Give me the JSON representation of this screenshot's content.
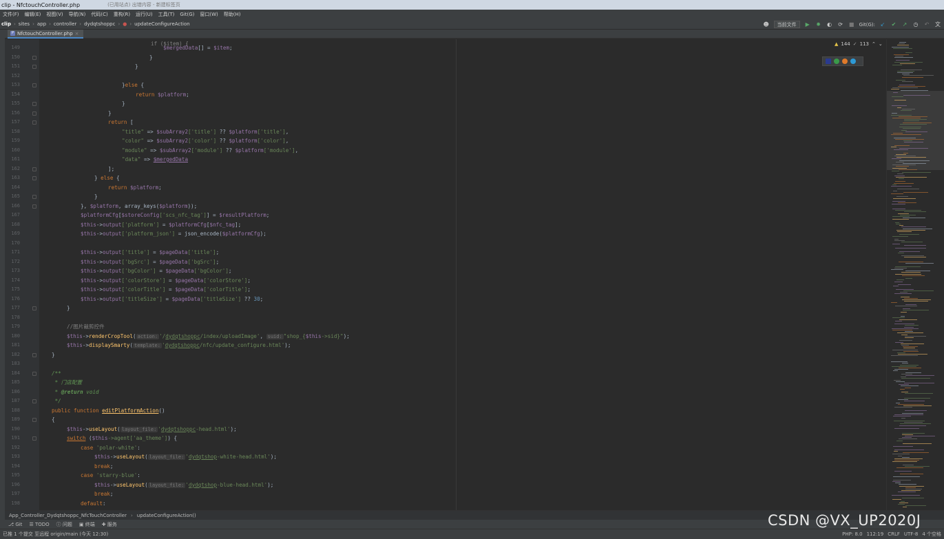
{
  "window": {
    "title": "clip - NfctouchController.php",
    "ghost_tab": "(已用站点) 出错内容 - 新建标签页"
  },
  "menu": [
    "文件(F)",
    "编辑(E)",
    "视图(V)",
    "导航(N)",
    "代码(C)",
    "重构(R)",
    "运行(U)",
    "工具(T)",
    "Git(G)",
    "窗口(W)",
    "帮助(H)"
  ],
  "breadcrumb": [
    "clip",
    "sites",
    "app",
    "controller",
    "dydqtshoppc",
    "updateConfigureAction"
  ],
  "toolbar": {
    "combo": "当前文件",
    "git_label": "Git(G):"
  },
  "tab": {
    "label": "NfctouchController.php",
    "icon": "php-file-icon"
  },
  "inspections": {
    "warnings": "144",
    "weak_warnings": "113"
  },
  "lines": [
    {
      "n": "148",
      "fold": true
    },
    {
      "n": "149"
    },
    {
      "n": "150",
      "fold": true
    },
    {
      "n": "151",
      "fold": true
    },
    {
      "n": "152"
    },
    {
      "n": "153",
      "fold": true
    },
    {
      "n": "154"
    },
    {
      "n": "155",
      "fold": true
    },
    {
      "n": "156",
      "fold": true
    },
    {
      "n": "157",
      "fold": true
    },
    {
      "n": "158"
    },
    {
      "n": "159"
    },
    {
      "n": "160"
    },
    {
      "n": "161"
    },
    {
      "n": "162",
      "fold": true
    },
    {
      "n": "163",
      "fold": true
    },
    {
      "n": "164"
    },
    {
      "n": "165",
      "fold": true
    },
    {
      "n": "166",
      "fold": true
    },
    {
      "n": "167"
    },
    {
      "n": "168"
    },
    {
      "n": "169"
    },
    {
      "n": "170"
    },
    {
      "n": "171"
    },
    {
      "n": "172"
    },
    {
      "n": "173"
    },
    {
      "n": "174"
    },
    {
      "n": "175"
    },
    {
      "n": "176"
    },
    {
      "n": "177",
      "fold": true
    },
    {
      "n": "178"
    },
    {
      "n": "179"
    },
    {
      "n": "180"
    },
    {
      "n": "181"
    },
    {
      "n": "182",
      "fold": true
    },
    {
      "n": "183"
    },
    {
      "n": "184",
      "fold": true
    },
    {
      "n": "185"
    },
    {
      "n": "186"
    },
    {
      "n": "187",
      "fold": true
    },
    {
      "n": "188"
    },
    {
      "n": "189",
      "fold": true
    },
    {
      "n": "190"
    },
    {
      "n": "191",
      "fold": true
    },
    {
      "n": "192"
    },
    {
      "n": "193"
    },
    {
      "n": "194"
    },
    {
      "n": "195"
    },
    {
      "n": "196"
    },
    {
      "n": "197"
    },
    {
      "n": "198"
    }
  ],
  "code": {
    "l148": "if ($item) {",
    "l149a": "$mergedData",
    "l149b": "[] = ",
    "l149c": "$item",
    "l149d": ";",
    "l150": "}",
    "l151": "}",
    "l153a": "}",
    "l153b": "else",
    "l153c": " {",
    "l154a": "return ",
    "l154b": "$platform",
    "l154c": ";",
    "l155": "}",
    "l156": "}",
    "l157a": "return",
    "l157b": " [",
    "l158a": "\"title\"",
    "l158b": " => ",
    "l158c": "$subArray2",
    "l158d": "['title']",
    "l158e": " ?? ",
    "l158f": "$platform",
    "l158g": "['title']",
    "l158h": ",",
    "l159a": "\"color\"",
    "l159b": " => ",
    "l159c": "$subArray2",
    "l159d": "['color']",
    "l159e": " ?? ",
    "l159f": "$platform",
    "l159g": "['color']",
    "l159h": ",",
    "l160a": "\"module\"",
    "l160b": " => ",
    "l160c": "$subArray2",
    "l160d": "['module']",
    "l160e": " ?? ",
    "l160f": "$platform",
    "l160g": "['module']",
    "l160h": ",",
    "l161a": "\"data\"",
    "l161b": " => ",
    "l161c": "$mergedData",
    "l162": "];",
    "l163a": "} ",
    "l163b": "else",
    "l163c": " {",
    "l164a": "return ",
    "l164b": "$platform",
    "l164c": ";",
    "l165": "}",
    "l166a": "}, ",
    "l166b": "$platform",
    "l166c": ", array_keys(",
    "l166d": "$platform",
    "l166e": "));",
    "l167a": "$platformCfg",
    "l167b": "[",
    "l167c": "$storeConfig",
    "l167d": "['scs_nfc_tag']",
    "l167e": "] = ",
    "l167f": "$resultPlatform",
    "l167g": ";",
    "l168a": "$this",
    "l168b": "->",
    "l168c": "output",
    "l168d": "['platform']",
    "l168e": " = ",
    "l168f": "$platformCfg",
    "l168g": "[",
    "l168h": "$nfc_tag",
    "l168i": "];",
    "l169a": "$this",
    "l169b": "->",
    "l169c": "output",
    "l169d": "['platform_json']",
    "l169e": " = json_encode(",
    "l169f": "$platformCfg",
    "l169g": ");",
    "o171k": "['title']",
    "o171v": "['title']",
    "o172k": "['bgSrc']",
    "o172v": "['bgSrc']",
    "o173k": "['bgColor']",
    "o173v": "['bgColor']",
    "o174k": "['colorStore']",
    "o174v": "['colorStore']",
    "o175k": "['colorTitle']",
    "o175v": "['colorTitle']",
    "o176k": "['titleSize']",
    "o176v": "['titleSize']",
    "o176x": " ?? ",
    "o176n": "30",
    "o176e": ";",
    "pagedata": "$pageData",
    "this": "$this",
    "arrow": "->",
    "output": "output",
    "assign": " = ",
    "semi": ";",
    "l177": "}",
    "l179": "//图片裁剪控件",
    "l180a": "$this",
    "l180b": "->",
    "l180c": "renderCropTool",
    "l180d": "(",
    "l180hint1": "action:",
    "l180e": "'/",
    "l180f": "dydqtshoppc",
    "l180g": "/index/uploadImage'",
    "l180h": ", ",
    "l180hint2": "suid:",
    "l180i": "\"shop_{",
    "l180j": "$this",
    "l180k": "->sid}\"",
    "l180l": ");",
    "l181a": "$this",
    "l181b": "->",
    "l181c": "displaySmarty",
    "l181d": "(",
    "l181hint": "template:",
    "l181e": "'",
    "l181f": "dydqtshoppc",
    "l181g": "/nfc/update_configure.html'",
    "l181h": ");",
    "l182": "}",
    "l184": "/**",
    "l185": " * 门店配置",
    "l186a": " * ",
    "l186b": "@return",
    "l186c": " void",
    "l187": " */",
    "l188a": "public function ",
    "l188b": "editPlatformAction",
    "l188c": "()",
    "l189": "{",
    "l190a": "$this",
    "l190b": "->",
    "l190c": "useLayout",
    "l190d": "(",
    "l190hint": "layout_file:",
    "l190e": "'",
    "l190f": "dydqtshoppc",
    "l190g": "-head.html'",
    "l190h": ");",
    "l191a": "switch",
    "l191b": " (",
    "l191c": "$this",
    "l191d": "->agent['aa_theme']",
    "l191e": ") {",
    "l192a": "case ",
    "l192b": "'polar-white'",
    "l192c": ":",
    "l193a": "$this",
    "l193b": "->",
    "l193c": "useLayout",
    "l193d": "(",
    "l193hint": "layout_file:",
    "l193e": "'",
    "l193f": "dydqtshop",
    "l193g": "-white-head.html'",
    "l193h": ");",
    "l194a": "break",
    "l194b": ";",
    "l195a": "case ",
    "l195b": "'starry-blue'",
    "l195c": ":",
    "l196a": "$this",
    "l196b": "->",
    "l196c": "useLayout",
    "l196d": "(",
    "l196hint": "layout_file:",
    "l196e": "'",
    "l196f": "dydqtshop",
    "l196g": "-blue-head.html'",
    "l196h": ");",
    "l197a": "break",
    "l197b": ";",
    "l198a": "default",
    "l198b": ":"
  },
  "footer_breadcrumb": [
    "App_Controller_Dydqtshoppc_NfcTouchController",
    "updateConfigureAction()"
  ],
  "toolwindows": [
    "Git",
    "TODO",
    "问题",
    "终端",
    "服务"
  ],
  "status": {
    "left": "已推 1 个提交 至远程 origin/main (今天 12:30)",
    "php": "PHP: 8.0",
    "pos": "112:19",
    "crlf": "CRLF",
    "enc": "UTF-8",
    "indent": "4 个空格"
  },
  "watermark": "CSDN @VX_UP2020J",
  "colors": {
    "background": "#2b2b2b",
    "keyword": "#cc7832",
    "variable": "#9876aa",
    "string": "#6a8759",
    "number": "#6897bb",
    "function": "#ffc66d",
    "comment": "#808080",
    "doc": "#629755"
  }
}
